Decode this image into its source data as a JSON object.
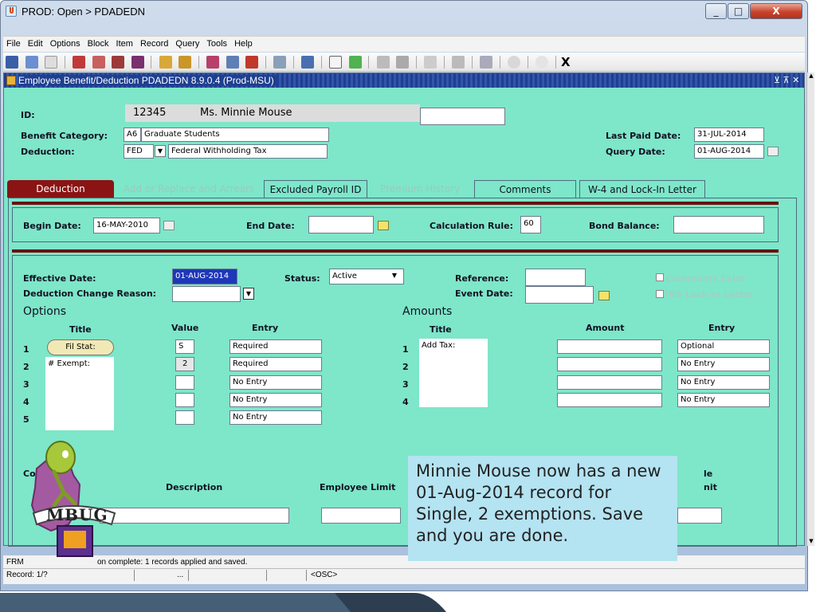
{
  "window": {
    "title": "PROD: Open > PDADEDN",
    "minimize": "_",
    "maximize": "□",
    "close": "X"
  },
  "menu": [
    "File",
    "Edit",
    "Options",
    "Block",
    "Item",
    "Record",
    "Query",
    "Tools",
    "Help"
  ],
  "toolbar": {
    "exit_label": "X"
  },
  "form": {
    "title": "Employee Benefit/Deduction  PDADEDN  8.9.0.4  (Prod-MSU)",
    "id_label": "ID:",
    "id_value": "12345",
    "name_value": "Ms. Minnie Mouse",
    "benefit_category_label": "Benefit Category:",
    "benefit_category_code": "A6",
    "benefit_category_desc": "Graduate Students",
    "deduction_label": "Deduction:",
    "deduction_code": "FED",
    "deduction_desc": "Federal Withholding Tax",
    "last_paid_date_label": "Last Paid Date:",
    "last_paid_date": "31-JUL-2014",
    "query_date_label": "Query Date:",
    "query_date": "01-AUG-2014"
  },
  "tabs": [
    {
      "label": "Deduction",
      "state": "active"
    },
    {
      "label": "Add or Replace and Arrears",
      "state": "disabled"
    },
    {
      "label": "Excluded Payroll ID",
      "state": "normal"
    },
    {
      "label": "Premium History",
      "state": "disabled"
    },
    {
      "label": "Comments",
      "state": "normal"
    },
    {
      "label": "W-4 and Lock-In Letter",
      "state": "normal"
    }
  ],
  "deduction_block": {
    "begin_date_label": "Begin Date:",
    "begin_date": "16-MAY-2010",
    "end_date_label": "End Date:",
    "end_date": "",
    "calc_rule_label": "Calculation Rule:",
    "calc_rule": "60",
    "bond_balance_label": "Bond Balance:",
    "bond_balance": ""
  },
  "detail_block": {
    "effective_date_label": "Effective Date:",
    "effective_date": "01-AUG-2014",
    "status_label": "Status:",
    "status": "Active",
    "reference_label": "Reference:",
    "reference": "",
    "comments_exist_label": "Comments Exist",
    "change_reason_label": "Deduction Change Reason:",
    "event_date_label": "Event Date:",
    "irs_lock_label": "IRS Lock-In Letter",
    "options_heading": "Options",
    "amounts_heading": "Amounts",
    "col_title": "Title",
    "col_value": "Value",
    "col_entry": "Entry",
    "col_amount": "Amount",
    "options": [
      {
        "num": "1",
        "title": "Fil Stat:",
        "value": "S",
        "entry": "Required"
      },
      {
        "num": "2",
        "title": "# Exempt:",
        "value": "2",
        "entry": "Required"
      },
      {
        "num": "3",
        "title": "",
        "value": "",
        "entry": "No Entry"
      },
      {
        "num": "4",
        "title": "",
        "value": "",
        "entry": "No Entry"
      },
      {
        "num": "5",
        "title": "",
        "value": "",
        "entry": "No Entry"
      }
    ],
    "amounts": [
      {
        "num": "1",
        "title": "Add Tax:",
        "amount": "",
        "entry": "Optional"
      },
      {
        "num": "2",
        "title": "",
        "amount": "",
        "entry": "No Entry"
      },
      {
        "num": "3",
        "title": "",
        "amount": "",
        "entry": "No Entry"
      },
      {
        "num": "4",
        "title": "",
        "amount": "",
        "entry": "No Entry"
      }
    ],
    "comb_label": "Comb",
    "comb_label2": "R",
    "description_label": "Description",
    "employee_limit_label": "Employee Limit",
    "right_label_1": "le",
    "right_label_2": "nit"
  },
  "status_bar": {
    "message_prefix": "FRM",
    "message": "on complete: 1 records applied and saved.",
    "record": "Record: 1/?",
    "ellipsis": "...",
    "osc": "<OSC>"
  },
  "logo": {
    "text": "MBUG"
  },
  "callout": {
    "text": "Minnie Mouse now has a new 01-Aug-2014 record for Single, 2 exemptions. Save and you are done."
  }
}
